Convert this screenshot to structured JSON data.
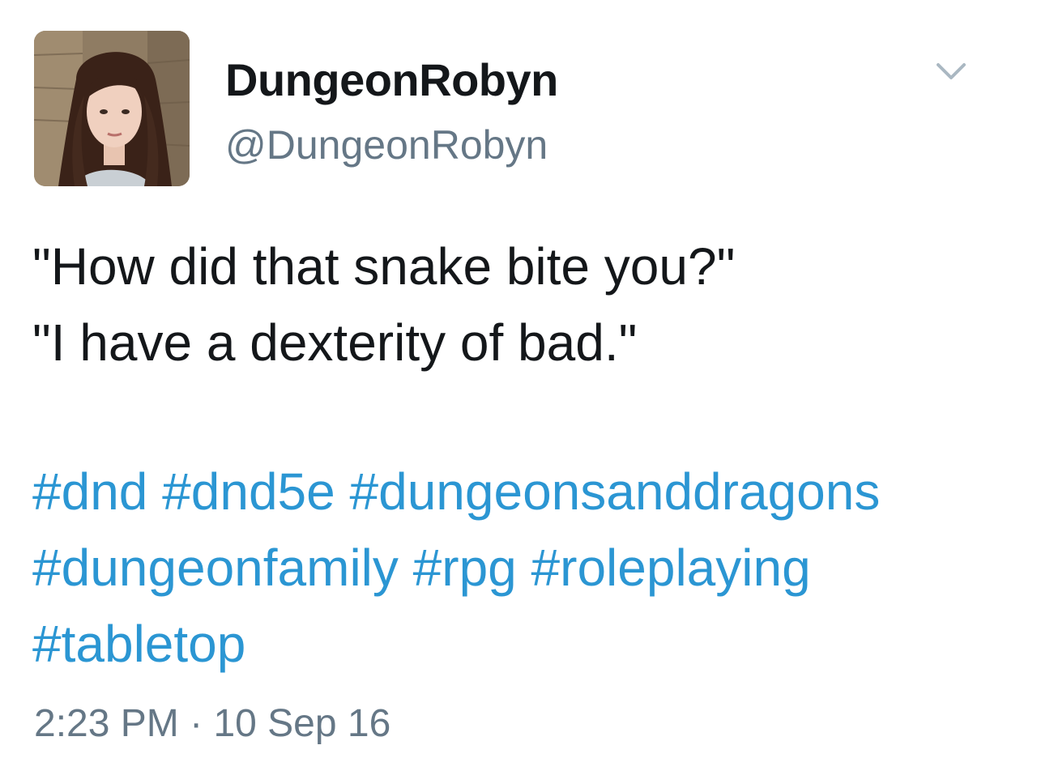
{
  "author": {
    "display_name": "DungeonRobyn",
    "handle": "@DungeonRobyn"
  },
  "menu": {
    "icon": "chevron-down-icon"
  },
  "tweet": {
    "lines": [
      "\"How did that snake bite you?\"",
      "\"I have a dexterity of bad.\""
    ],
    "hashtag_rows": [
      [
        "#dnd",
        "#dnd5e",
        "#dungeonsanddragons"
      ],
      [
        "#dungeonfamily",
        "#rpg",
        "#roleplaying"
      ],
      [
        "#tabletop"
      ]
    ]
  },
  "timestamp": {
    "time": "2:23 PM",
    "separator": "·",
    "date": "10 Sep 16"
  },
  "colors": {
    "text": "#14171a",
    "secondary": "#657786",
    "hashtag": "#2b96d3",
    "background": "#ffffff"
  }
}
